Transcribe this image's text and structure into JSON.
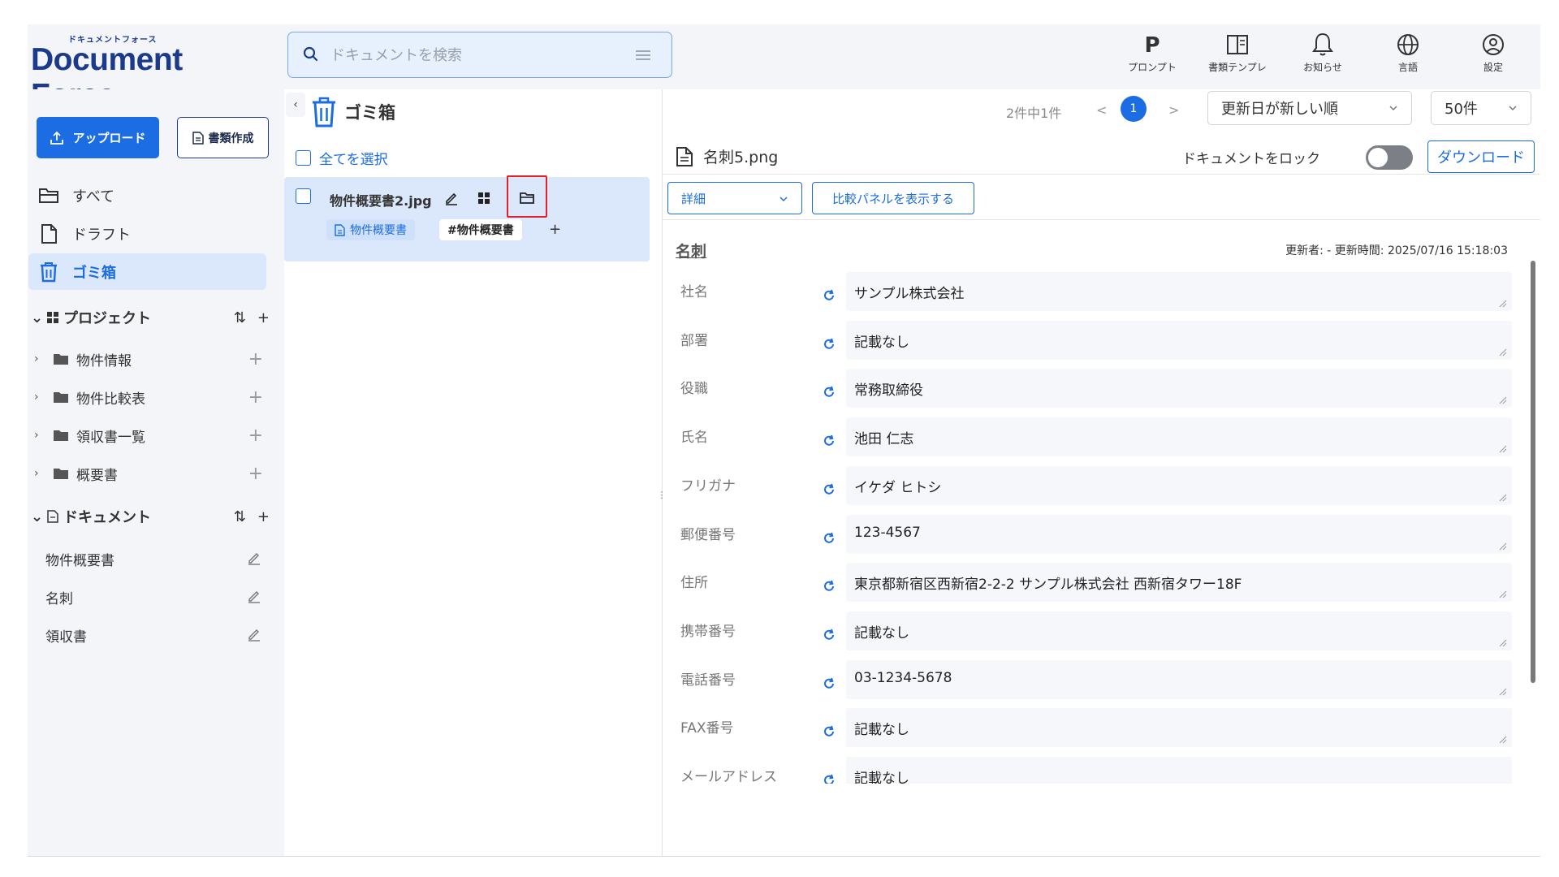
{
  "logo": {
    "kana": "ドキュメントフォース",
    "main": "Document Force"
  },
  "search": {
    "placeholder": "ドキュメントを検索"
  },
  "toolbar": [
    {
      "label": "プロンプト",
      "icon": "p-icon"
    },
    {
      "label": "書類テンプレ",
      "icon": "template-icon"
    },
    {
      "label": "お知らせ",
      "icon": "bell-icon"
    },
    {
      "label": "言語",
      "icon": "globe-icon"
    },
    {
      "label": "設定",
      "icon": "user-circle-icon"
    }
  ],
  "sidebar": {
    "upload_label": "アップロード",
    "create_label": "書類作成",
    "nav": [
      {
        "label": "すべて",
        "icon": "folder-open-icon"
      },
      {
        "label": "ドラフト",
        "icon": "file-icon"
      },
      {
        "label": "ゴミ箱",
        "icon": "trash-icon",
        "active": true
      }
    ],
    "projects_title": "プロジェクト",
    "projects": [
      "物件情報",
      "物件比較表",
      "領収書一覧",
      "概要書"
    ],
    "documents_title": "ドキュメント",
    "documents": [
      "物件概要書",
      "名刺",
      "領収書"
    ]
  },
  "middle": {
    "title": "ゴミ箱",
    "select_all": "全てを選択",
    "card": {
      "name": "物件概要書2.jpg",
      "doc_chip": "物件概要書",
      "tag_chip": "#物件概要書",
      "plus": "+"
    }
  },
  "pager": {
    "count": "2件中1件",
    "prev": "<",
    "page": "1",
    "next": ">",
    "sort": "更新日が新しい順",
    "per_page": "50件"
  },
  "detail": {
    "file_name": "名刺5.png",
    "lock_label": "ドキュメントをロック",
    "lock_on": false,
    "download_label": "ダウンロード",
    "view_select": "詳細",
    "compare_label": "比較パネルを表示する",
    "form_title": "名刺",
    "meta": "更新者:  -   更新時間:  2025/07/16 15:18:03",
    "fields": [
      {
        "label": "社名",
        "value": "サンプル株式会社"
      },
      {
        "label": "部署",
        "value": "記載なし"
      },
      {
        "label": "役職",
        "value": "常務取締役"
      },
      {
        "label": "氏名",
        "value": "池田 仁志"
      },
      {
        "label": "フリガナ",
        "value": "イケダ ヒトシ"
      },
      {
        "label": "郵便番号",
        "value": "123-4567"
      },
      {
        "label": "住所",
        "value": "東京都新宿区西新宿2-2-2 サンプル株式会社 西新宿タワー18F"
      },
      {
        "label": "携帯番号",
        "value": "記載なし"
      },
      {
        "label": "電話番号",
        "value": "03-1234-5678"
      },
      {
        "label": "FAX番号",
        "value": "記載なし"
      },
      {
        "label": "メールアドレス",
        "value": "記載なし"
      }
    ]
  },
  "colors": {
    "accent": "#1c6ce3",
    "brand": "#1b3a8c",
    "active_bg": "#dbe8fc",
    "highlight": "#e0202a"
  }
}
